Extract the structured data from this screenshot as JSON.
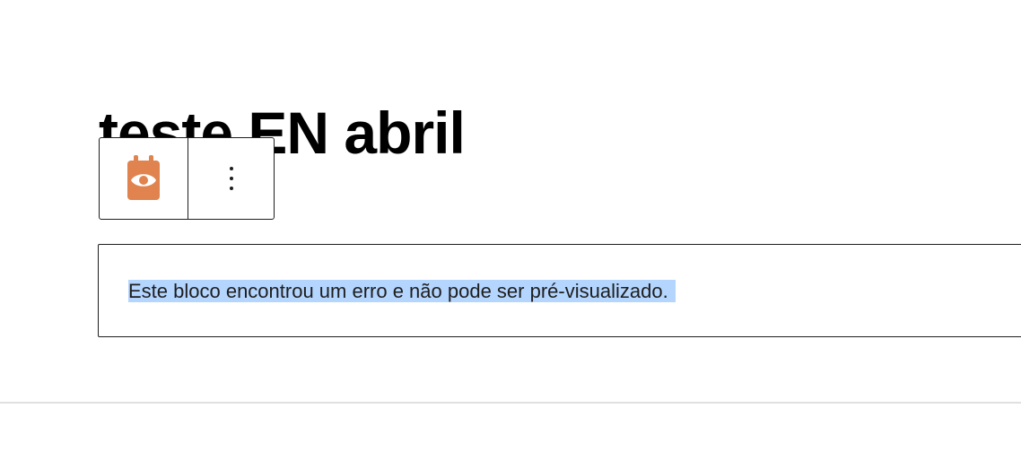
{
  "post": {
    "title": "teste EN abril"
  },
  "toolbar": {
    "block_icon": "calendar-eye-icon",
    "block_icon_color": "#e0834f",
    "options_icon": "more-vertical-icon"
  },
  "error_block": {
    "message": "Este bloco encontrou um erro e não pode ser pré-visualizado."
  },
  "colors": {
    "selection": "#b4d5fe",
    "border": "#1e1e1e",
    "divider": "#e0e0e0"
  }
}
